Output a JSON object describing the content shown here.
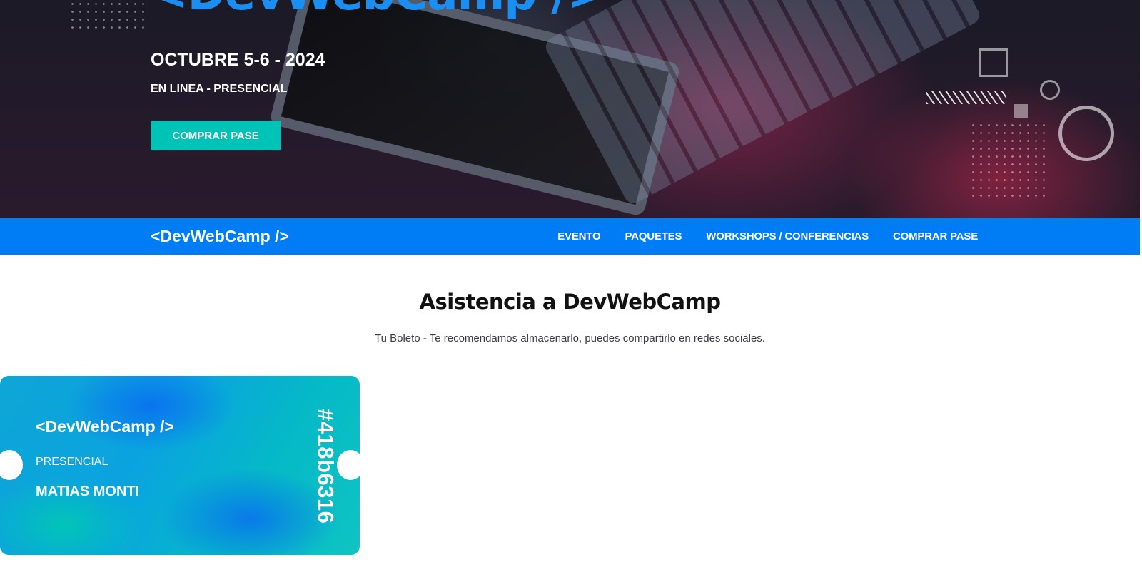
{
  "hero": {
    "title": "<DevWebCamp />",
    "date": "OCTUBRE 5-6 - 2024",
    "mode": "EN LINEA - PRESENCIAL",
    "cta_label": "COMPRAR PASE"
  },
  "nav": {
    "logo": "<DevWebCamp />",
    "links": [
      "EVENTO",
      "PAQUETES",
      "WORKSHOPS / CONFERENCIAS",
      "COMPRAR PASE"
    ]
  },
  "main": {
    "title": "Asistencia a DevWebCamp",
    "description": "Tu Boleto - Te recomendamos almacenarlo, puedes compartirlo en redes sociales."
  },
  "ticket": {
    "logo": "<DevWebCamp />",
    "type": "PRESENCIAL",
    "name": "MATIAS MONTI",
    "code": "#418b6316"
  },
  "colors": {
    "nav_blue": "#007df4",
    "accent_teal": "#00c3b8",
    "hero_title_blue": "#1b8ef2"
  }
}
